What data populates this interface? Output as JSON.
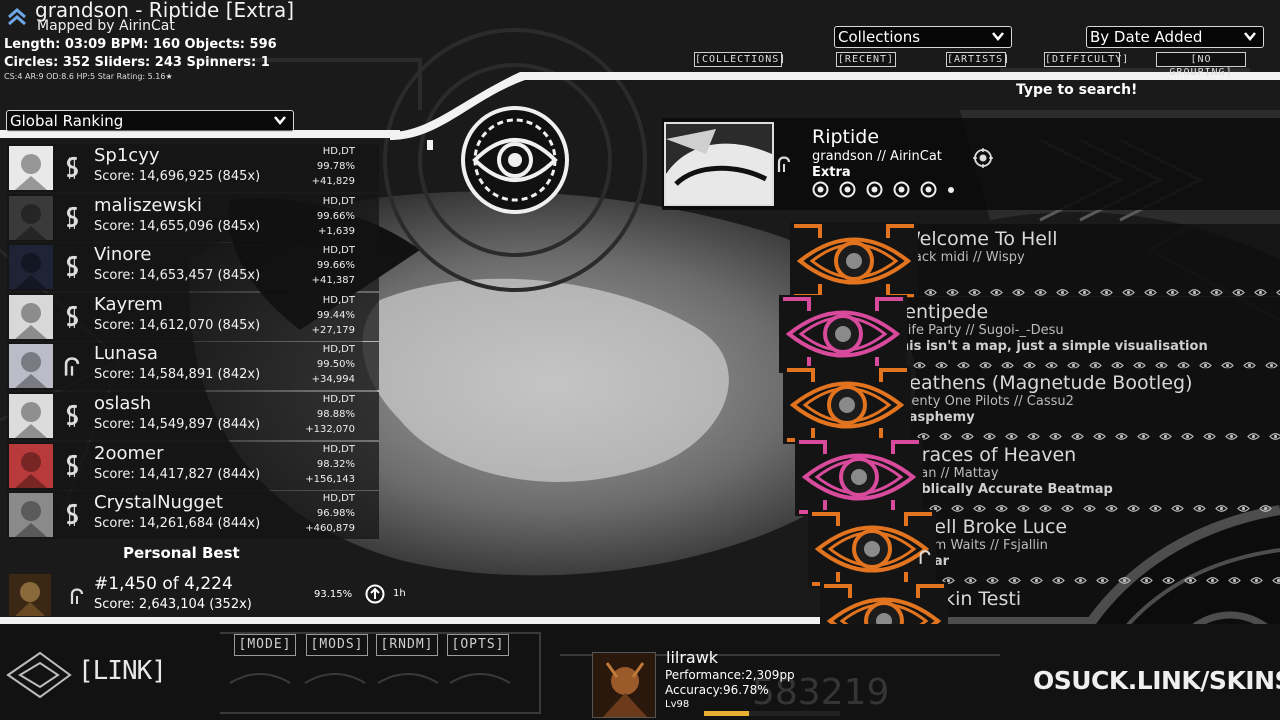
{
  "beatmap": {
    "title_line": "grandson - Riptide [Extra]",
    "mapper_line": "Mapped by AirinCat",
    "stats_line1": "Length: 03:09 BPM: 160 Objects: 596",
    "stats_line2": "Circles: 352 Sliders: 243 Spinners: 1",
    "stats_line3": "CS:4 AR:9 OD:8.6 HP:5 Star Rating: 5.16★"
  },
  "leaderboard": {
    "type_dropdown": "Global Ranking",
    "rows": [
      {
        "name": "Sp1cyy",
        "score": "Score: 14,696,925 (845x)",
        "mods": "HD,DT",
        "acc": "99.78%",
        "diff": "+41,829"
      },
      {
        "name": "maliszewski",
        "score": "Score: 14,655,096 (845x)",
        "mods": "HD,DT",
        "acc": "99.66%",
        "diff": "+1,639"
      },
      {
        "name": "Vinore",
        "score": "Score: 14,653,457 (845x)",
        "mods": "HD,DT",
        "acc": "99.66%",
        "diff": "+41,387"
      },
      {
        "name": "Kayrem",
        "score": "Score: 14,612,070 (845x)",
        "mods": "HD,DT",
        "acc": "99.44%",
        "diff": "+27,179"
      },
      {
        "name": "Lunasa",
        "score": "Score: 14,584,891 (842x)",
        "mods": "HD,DT",
        "acc": "99.50%",
        "diff": "+34,994"
      },
      {
        "name": "oslash",
        "score": "Score: 14,549,897 (844x)",
        "mods": "HD,DT",
        "acc": "98.88%",
        "diff": "+132,070"
      },
      {
        "name": "2oomer",
        "score": "Score: 14,417,827 (844x)",
        "mods": "HD,DT",
        "acc": "98.32%",
        "diff": "+156,143"
      },
      {
        "name": "CrystalNugget",
        "score": "Score: 14,261,684 (844x)",
        "mods": "HD,DT",
        "acc": "96.98%",
        "diff": "+460,879"
      }
    ],
    "personal_best_label": "Personal Best",
    "personal_best": {
      "rank": "#1,450 of 4,224",
      "score": "Score: 2,643,104 (352x)",
      "acc": "93.15%",
      "time": "1h"
    }
  },
  "top_bar": {
    "collections": "Collections",
    "sort": "By Date Added",
    "tabs": [
      "[COLLECTIONS]",
      "[RECENT]",
      "[ARTISTS]",
      "[DIFFICULTY]",
      "[NO GROUPING]"
    ],
    "search_hint": "Type to search!"
  },
  "selected": {
    "title": "Riptide",
    "artist": "grandson // AirinCat",
    "difficulty": "Extra"
  },
  "songs": [
    {
      "title": "Welcome To Hell",
      "artist": "black midi // Wispy",
      "diff": ""
    },
    {
      "title": "Centipede",
      "artist": "Knife Party // Sugoi-_-Desu",
      "diff": "This isn't a map, just a simple visualisation"
    },
    {
      "title": "Heathens (Magnetude Bootleg)",
      "artist": "Twenty One Pilots // Cassu2",
      "diff": "blasphemy"
    },
    {
      "title": "Graces of Heaven",
      "artist": "aran // Mattay",
      "diff": "Biblically Accurate Beatmap"
    },
    {
      "title": "Hell Broke Luce",
      "artist": "Tom Waits // Fsjallin",
      "diff": "War"
    },
    {
      "title": "Skin Testi",
      "artist": "",
      "diff": ""
    }
  ],
  "bottom": {
    "buttons": [
      "[MODE]",
      "[MODS]",
      "[RNDM]",
      "[OPTS]"
    ],
    "logo_text": "[LINK]",
    "user": {
      "name": "lilrawk",
      "performance": "Performance:2,309pp",
      "accuracy": "Accuracy:96.78%",
      "level": "Lv98",
      "level_progress": 0.33
    },
    "bg_number": "583219",
    "watermark": "OSUCK.LINK/SKINS"
  },
  "colors": {
    "orange": "#e3741f",
    "pink": "#d84a9c",
    "white": "#f2f2f2"
  }
}
